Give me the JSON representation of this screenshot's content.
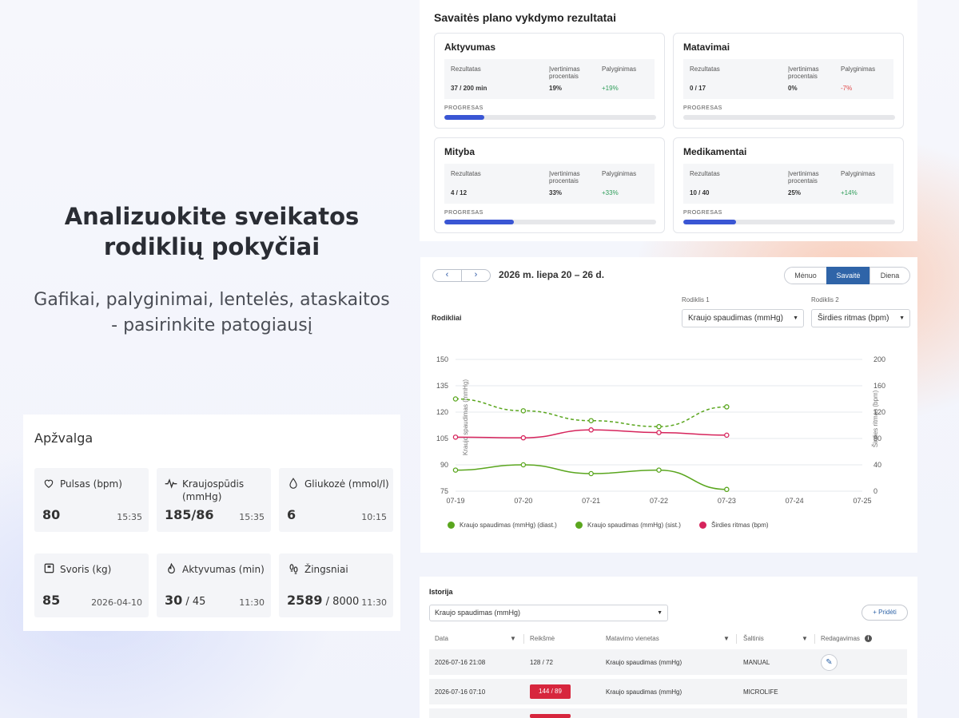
{
  "hero": {
    "title": "Analizuokite sveikatos rodiklių pokyčiai",
    "subtitle": "Gafikai, palyginimai, lentelės, ataskaitos - pasirinkite patogiausį"
  },
  "overview": {
    "title": "Apžvalga",
    "tiles": [
      {
        "icon": "heart-icon",
        "label": "Pulsas (bpm)",
        "value": "80",
        "value_extra": "",
        "time": "15:35"
      },
      {
        "icon": "pulse-wave-icon",
        "label": "Kraujospūdis (mmHg)",
        "value": "185/86",
        "value_extra": "",
        "time": "15:35"
      },
      {
        "icon": "drop-icon",
        "label": "Gliukozė (mmol/l)",
        "value": "6",
        "value_extra": "",
        "time": "10:15"
      },
      {
        "icon": "scale-icon",
        "label": "Svoris (kg)",
        "value": "85",
        "value_extra": "",
        "time": "2026-04-10"
      },
      {
        "icon": "flame-icon",
        "label": "Aktyvumas (min)",
        "value": "30",
        "value_extra": " / 45",
        "time": "11:30"
      },
      {
        "icon": "footsteps-icon",
        "label": "Žingsniai",
        "value": "2589",
        "value_extra": " / 8000",
        "time": "11:30"
      }
    ]
  },
  "plan": {
    "title": "Savaitės plano vykdymo rezultatai",
    "col_result": "Rezultatas",
    "col_percent": "Įvertinimas procentais",
    "col_compare": "Palyginimas",
    "progress_label": "PROGRESAS",
    "cards": [
      {
        "title": "Aktyvumas",
        "result": "37 / 200 min",
        "percent": "19%",
        "compare": "+19%",
        "trend": "pos",
        "progress": 0.19
      },
      {
        "title": "Matavimai",
        "result": "0 / 17",
        "percent": "0%",
        "compare": "-7%",
        "trend": "neg",
        "progress": 0
      },
      {
        "title": "Mityba",
        "result": "4 / 12",
        "percent": "33%",
        "compare": "+33%",
        "trend": "pos",
        "progress": 0.33
      },
      {
        "title": "Medikamentai",
        "result": "10 / 40",
        "percent": "25%",
        "compare": "+14%",
        "trend": "pos",
        "progress": 0.25
      }
    ]
  },
  "chart_panel": {
    "prev": "‹",
    "next": "›",
    "date_range": "2026 m. liepa 20 – 26 d.",
    "views": [
      "Mėnuo",
      "Savaitė",
      "Diena"
    ],
    "active_view": "Savaitė",
    "section_label": "Rodikliai",
    "select1_label": "Rodiklis 1",
    "select1_value": "Kraujo spaudimas (mmHg)",
    "select2_label": "Rodiklis 2",
    "select2_value": "Širdies ritmas (bpm)",
    "colors": {
      "green": "#5aa61e",
      "red": "#d6245c",
      "grid": "#e6e8ec"
    }
  },
  "chart_data": {
    "type": "line",
    "x": [
      "07-19",
      "07-20",
      "07-21",
      "07-22",
      "07-23",
      "07-24",
      "07-25"
    ],
    "ylabel": "Kraujo spaudimas (mmHg)",
    "y2label": "Širdies ritmas (bpm)",
    "ylim": [
      75,
      150
    ],
    "y2lim": [
      0,
      200
    ],
    "yticks": [
      75,
      90,
      105,
      120,
      135,
      150
    ],
    "y2ticks": [
      0,
      40,
      80,
      120,
      160,
      200
    ],
    "series": [
      {
        "name": "Kraujo spaudimas (mmHg) (diast.)",
        "axis": "y2",
        "style": "dashed",
        "color": "#5aa61e",
        "values": [
          140,
          122,
          107,
          98,
          128,
          null,
          null
        ]
      },
      {
        "name": "Kraujo spaudimas (mmHg) (sist.)",
        "axis": "y",
        "style": "solid",
        "color": "#5aa61e",
        "values": [
          87,
          90,
          85,
          87,
          76,
          null,
          null
        ]
      },
      {
        "name": "Širdies ritmas (bpm)",
        "axis": "y2",
        "style": "solid",
        "color": "#d6245c",
        "values": [
          82,
          81,
          93,
          89,
          85,
          null,
          null
        ]
      }
    ]
  },
  "history": {
    "title": "Istorija",
    "select_value": "Kraujo spaudimas (mmHg)",
    "add_label": "+ Pridėti",
    "columns": [
      "Data",
      "Reikšmė",
      "Matavimo vienetas",
      "Šaltinis",
      "Redagavimas"
    ],
    "rows": [
      {
        "date": "2026-07-16 21:08",
        "value": "128 / 72",
        "flag": false,
        "unit": "Kraujo spaudimas (mmHg)",
        "source": "MANUAL",
        "editable": true
      },
      {
        "date": "2026-07-16 07:10",
        "value": "144 / 89",
        "flag": true,
        "unit": "Kraujo spaudimas (mmHg)",
        "source": "MICROLIFE",
        "editable": false
      }
    ]
  }
}
